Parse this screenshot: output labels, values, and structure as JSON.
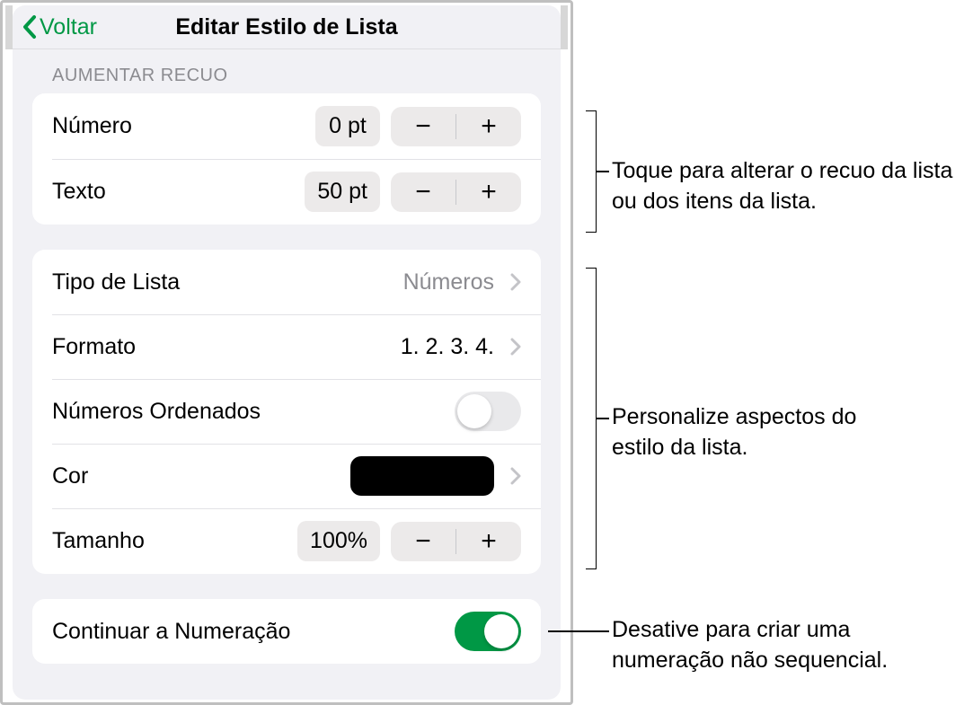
{
  "header": {
    "back_label": "Voltar",
    "title": "Editar Estilo de Lista"
  },
  "indent_section": {
    "label": "AUMENTAR RECUO",
    "number": {
      "label": "Número",
      "value": "0 pt"
    },
    "text": {
      "label": "Texto",
      "value": "50 pt"
    }
  },
  "style_section": {
    "list_type": {
      "label": "Tipo de Lista",
      "value": "Números"
    },
    "format": {
      "label": "Formato",
      "value": "1. 2. 3. 4."
    },
    "ordered_numbers": {
      "label": "Números Ordenados",
      "on": false
    },
    "color": {
      "label": "Cor",
      "hex": "#000000"
    },
    "size": {
      "label": "Tamanho",
      "value": "100%"
    }
  },
  "continue_section": {
    "continue_numbering": {
      "label": "Continuar a Numeração",
      "on": true
    }
  },
  "annotations": {
    "a1": "Toque para alterar o recuo da lista ou dos itens da lista.",
    "a2": "Personalize aspectos do estilo da lista.",
    "a3": "Desative para criar uma numeração não sequencial."
  }
}
